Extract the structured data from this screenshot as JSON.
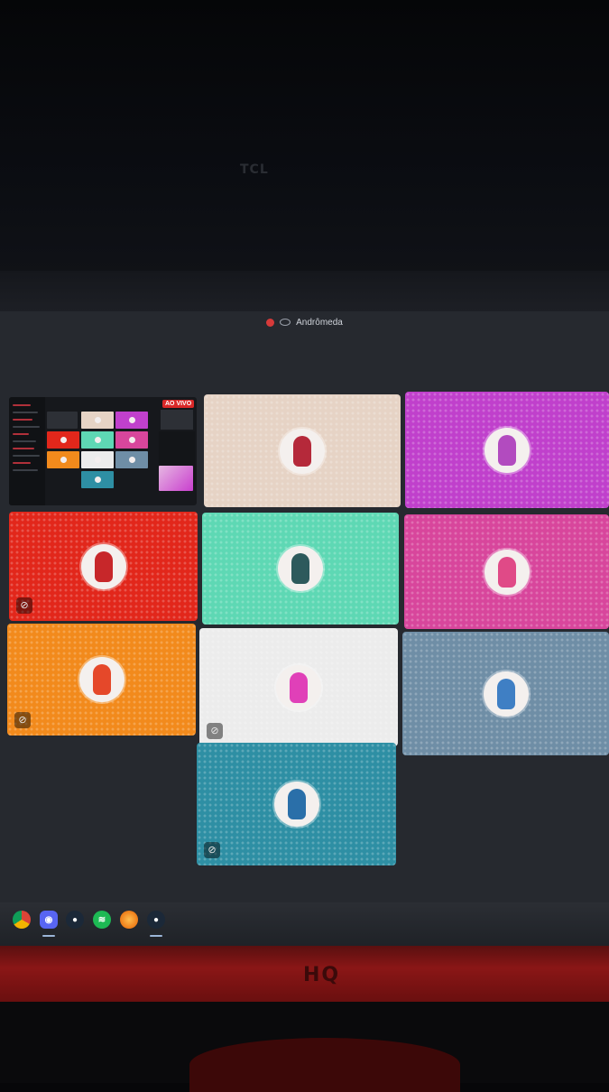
{
  "tv": {
    "brand": "TCL"
  },
  "window": {
    "title": "Andrômeda",
    "title_icon": "app-logo-icon"
  },
  "preview": {
    "live_badge": "AO VIVO"
  },
  "participants": [
    {
      "id": "p1",
      "color": "#e6d3c5",
      "avatar_color": "#b5293a",
      "muted": false
    },
    {
      "id": "p2",
      "color": "#c040cc",
      "avatar_color": "#b24bbf",
      "muted": false
    },
    {
      "id": "p3",
      "color": "#e2271b",
      "avatar_color": "#c7272a",
      "muted": true,
      "mute_icon": "mic-off-icon"
    },
    {
      "id": "p4",
      "color": "#5ed8b4",
      "avatar_color": "#2d5a5c",
      "muted": false
    },
    {
      "id": "p5",
      "color": "#d8469c",
      "avatar_color": "#e04a87",
      "muted": false
    },
    {
      "id": "p6",
      "color": "#f28a1c",
      "avatar_color": "#e5482a",
      "muted": true,
      "mute_icon": "mic-off-icon"
    },
    {
      "id": "p7",
      "color": "#ececec",
      "avatar_color": "#e040b8",
      "muted": true,
      "mute_icon": "mic-off-icon"
    },
    {
      "id": "p8",
      "color": "#6f8ea6",
      "avatar_color": "#3f7fc4",
      "muted": false
    },
    {
      "id": "p9",
      "color": "#2e8fa4",
      "avatar_color": "#2a6fa9",
      "muted": true,
      "mute_icon": "mic-off-icon"
    }
  ],
  "taskbar": {
    "icons": [
      "chrome-icon",
      "discord-icon",
      "steam-icon",
      "spotify-icon",
      "firefox-icon",
      "steam-icon"
    ],
    "active": [
      "discord-icon",
      "steam-icon"
    ]
  },
  "monitor": {
    "brand": "HQ"
  }
}
